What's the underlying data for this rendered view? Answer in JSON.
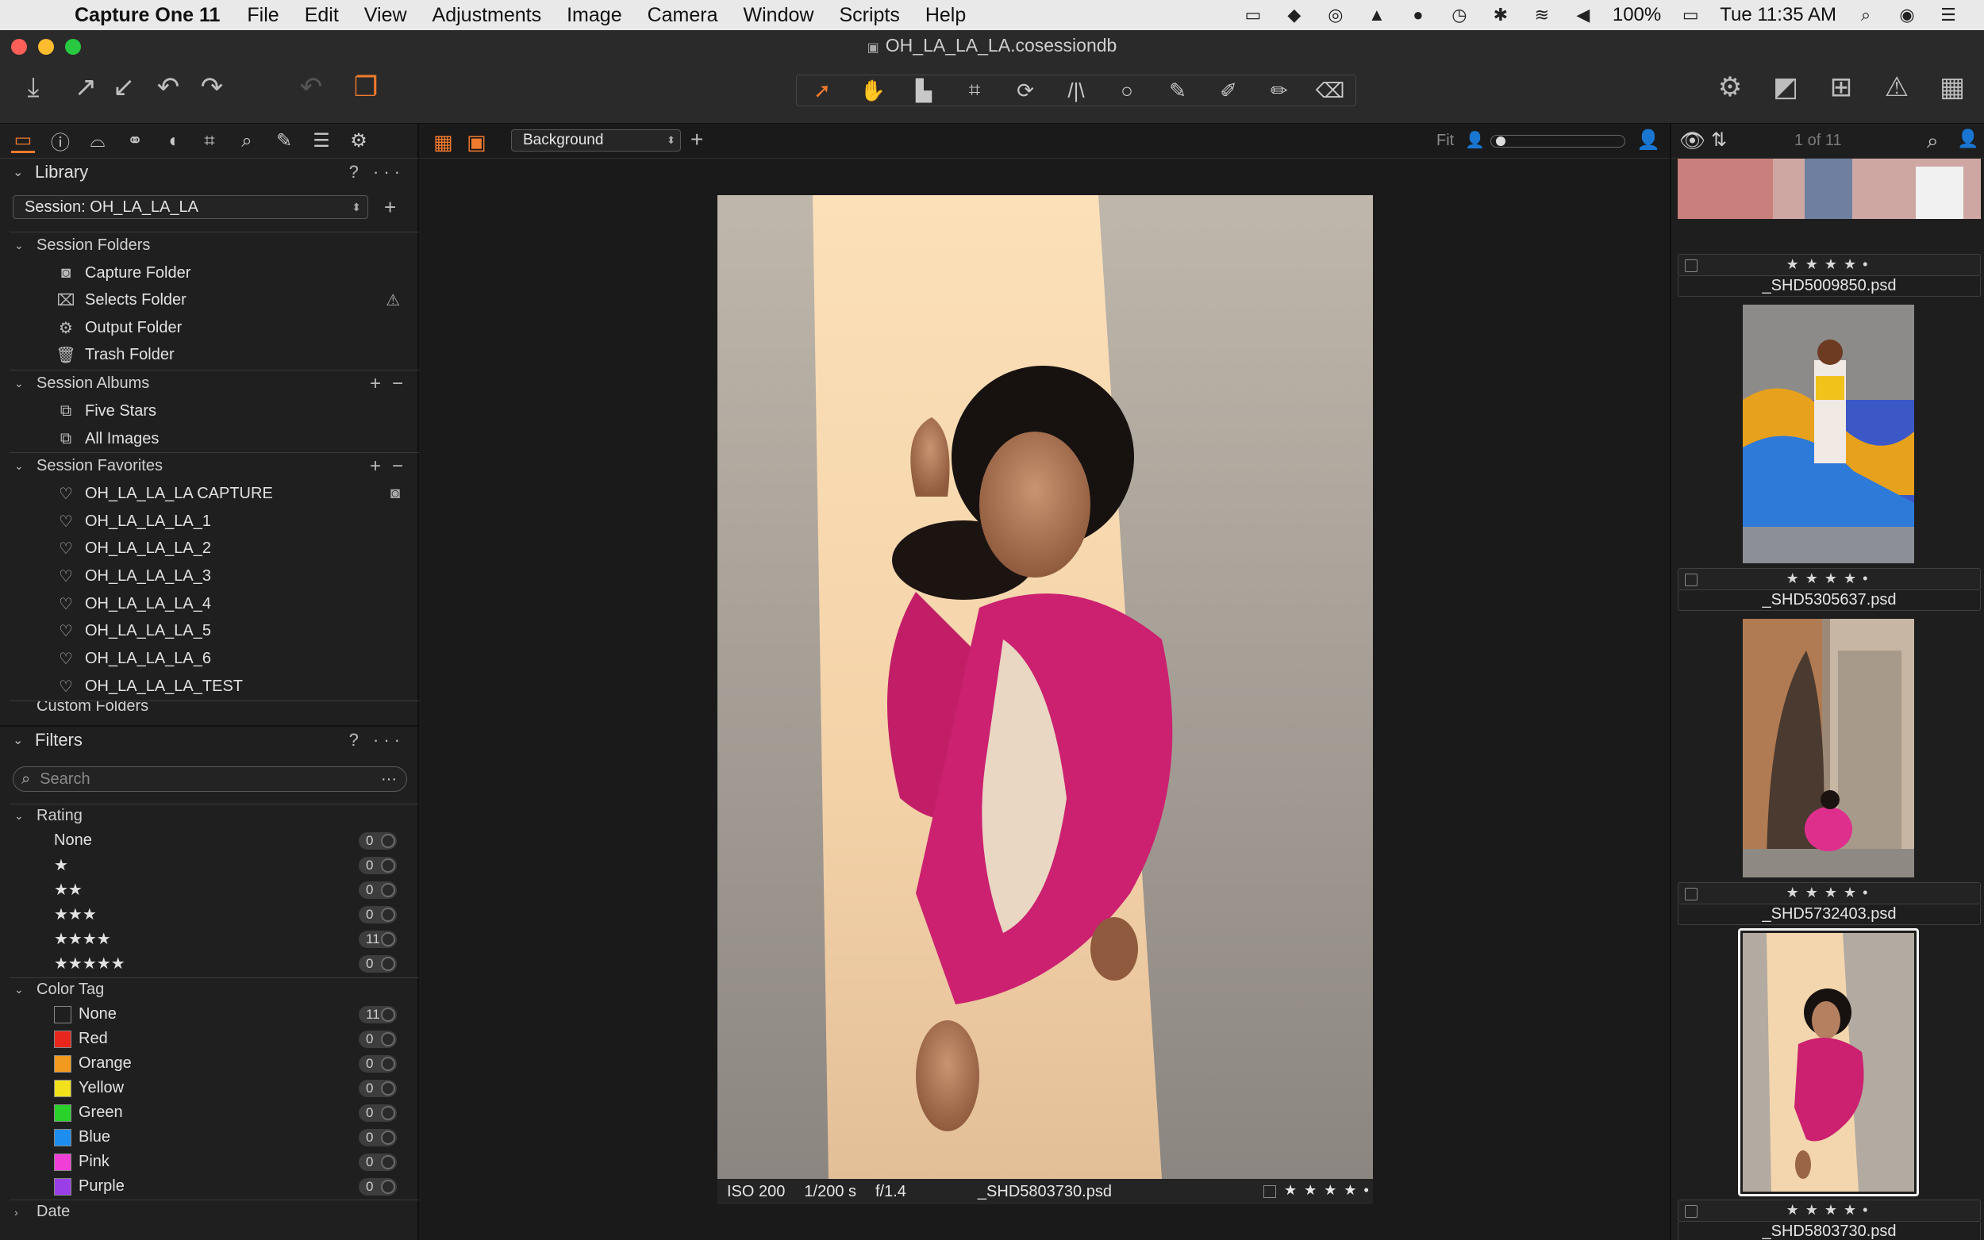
{
  "menubar": {
    "app_name": "Capture One 11",
    "items": [
      "File",
      "Edit",
      "View",
      "Adjustments",
      "Image",
      "Camera",
      "Window",
      "Scripts",
      "Help"
    ],
    "battery": "100%",
    "clock": "Tue 11:35 AM"
  },
  "window": {
    "title": "OH_LA_LA_LA.cosessiondb"
  },
  "library": {
    "header": "Library",
    "help": "?",
    "more": "···",
    "session_select": "Session: OH_LA_LA_LA",
    "session_folders": {
      "label": "Session Folders",
      "items": [
        "Capture Folder",
        "Selects Folder",
        "Output Folder",
        "Trash Folder"
      ]
    },
    "session_albums": {
      "label": "Session Albums",
      "items": [
        "Five Stars",
        "All Images"
      ]
    },
    "session_favorites": {
      "label": "Session Favorites",
      "items": [
        "OH_LA_LA_LA CAPTURE",
        "OH_LA_LA_LA_1",
        "OH_LA_LA_LA_2",
        "OH_LA_LA_LA_3",
        "OH_LA_LA_LA_4",
        "OH_LA_LA_LA_5",
        "OH_LA_LA_LA_6",
        "OH_LA_LA_LA_TEST"
      ]
    },
    "custom_folders_label": "Custom Folders"
  },
  "filters": {
    "header": "Filters",
    "help": "?",
    "more": "···",
    "search_placeholder": "Search",
    "rating": {
      "label": "Rating",
      "rows": [
        {
          "label": "None",
          "count": "0"
        },
        {
          "label": "★",
          "count": "0"
        },
        {
          "label": "★★",
          "count": "0"
        },
        {
          "label": "★★★",
          "count": "0"
        },
        {
          "label": "★★★★",
          "count": "11"
        },
        {
          "label": "★★★★★",
          "count": "0"
        }
      ]
    },
    "color_tag": {
      "label": "Color Tag",
      "rows": [
        {
          "label": "None",
          "count": "11",
          "color": "#1f1f1f"
        },
        {
          "label": "Red",
          "count": "0",
          "color": "#e8261d"
        },
        {
          "label": "Orange",
          "count": "0",
          "color": "#f29a1f"
        },
        {
          "label": "Yellow",
          "count": "0",
          "color": "#f2e21c"
        },
        {
          "label": "Green",
          "count": "0",
          "color": "#2ad12a"
        },
        {
          "label": "Blue",
          "count": "0",
          "color": "#1d8ef0"
        },
        {
          "label": "Pink",
          "count": "0",
          "color": "#ef3fd6"
        },
        {
          "label": "Purple",
          "count": "0",
          "color": "#9a3ee8"
        }
      ]
    },
    "date_label": "Date"
  },
  "viewer": {
    "background_select": "Background",
    "fit_label": "Fit",
    "caption": {
      "iso": "ISO 200",
      "shutter": "1/200 s",
      "aperture": "f/1.4",
      "filename": "_SHD5803730.psd",
      "stars": "★ ★ ★ ★ •"
    }
  },
  "browser": {
    "counter": "1 of 11",
    "thumbnails": [
      {
        "name": "_SHD5009850.psd",
        "stars": "★★★★•"
      },
      {
        "name": "_SHD5305637.psd",
        "stars": "★★★★•"
      },
      {
        "name": "_SHD5732403.psd",
        "stars": "★★★★•"
      },
      {
        "name": "_SHD5803730.psd",
        "stars": "★★★★•"
      }
    ]
  },
  "colors": {
    "accent": "#f07a2e",
    "panel_bg": "#1f1f1f",
    "viewer_bg": "#1a1a1a"
  }
}
